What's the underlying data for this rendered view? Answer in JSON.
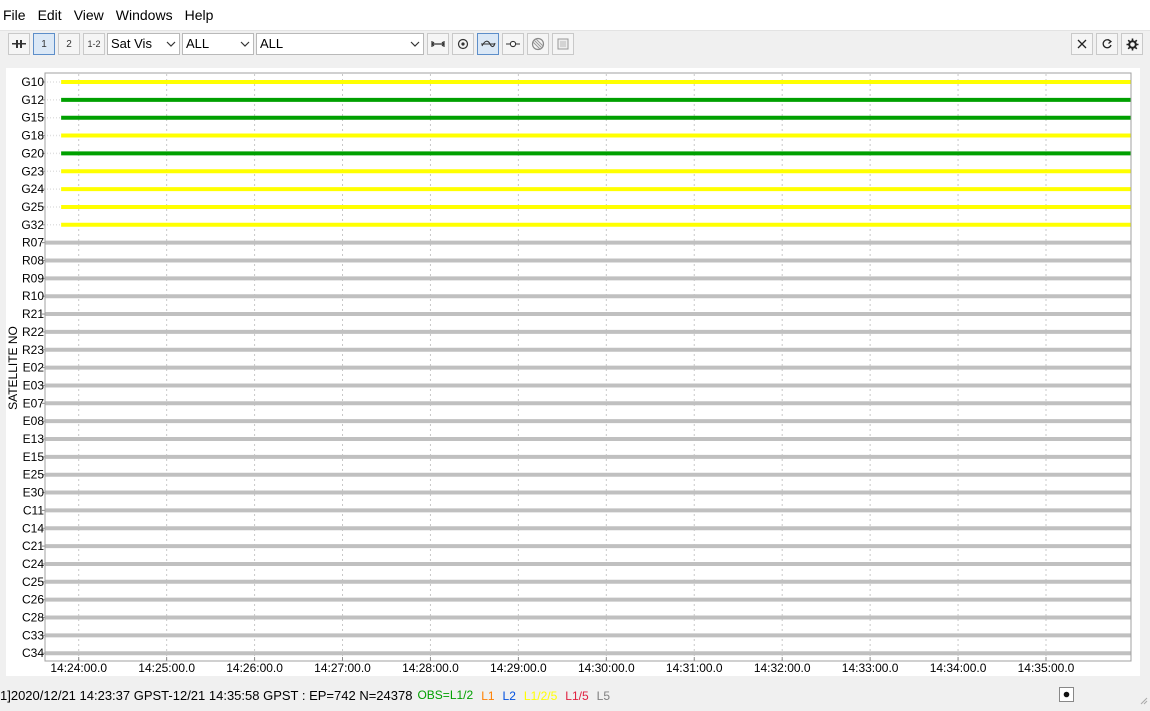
{
  "menu": [
    "File",
    "Edit",
    "View",
    "Windows",
    "Help"
  ],
  "toolbar": {
    "btn_1": "1",
    "btn_2": "2",
    "btn_12": "1-2",
    "plot_type": "Sat Vis",
    "sys_filter": "ALL",
    "sat_filter": "ALL"
  },
  "chart_data": {
    "type": "timeline",
    "ylabel": "SATELLITE NO",
    "x_ticks": [
      "14:24:00.0",
      "14:25:00.0",
      "14:26:00.0",
      "14:27:00.0",
      "14:28:00.0",
      "14:29:00.0",
      "14:30:00.0",
      "14:31:00.0",
      "14:32:00.0",
      "14:33:00.0",
      "14:34:00.0",
      "14:35:00.0"
    ],
    "x_range": [
      "14:23:37",
      "14:35:58"
    ],
    "colors": {
      "L1/2": "#00a000",
      "L1/2/5": "#ffff00",
      "none": "#c0c0c0"
    },
    "satellites": [
      {
        "id": "G10",
        "obs": "L1/2/5",
        "start": "14:23:48"
      },
      {
        "id": "G12",
        "obs": "L1/2",
        "start": "14:23:48"
      },
      {
        "id": "G15",
        "obs": "L1/2",
        "start": "14:23:48"
      },
      {
        "id": "G18",
        "obs": "L1/2/5",
        "start": "14:23:48"
      },
      {
        "id": "G20",
        "obs": "L1/2",
        "start": "14:23:48"
      },
      {
        "id": "G23",
        "obs": "L1/2/5",
        "start": "14:23:48"
      },
      {
        "id": "G24",
        "obs": "L1/2/5",
        "start": "14:23:48"
      },
      {
        "id": "G25",
        "obs": "L1/2/5",
        "start": "14:23:48"
      },
      {
        "id": "G32",
        "obs": "L1/2/5",
        "start": "14:23:48"
      },
      {
        "id": "R07",
        "obs": "none"
      },
      {
        "id": "R08",
        "obs": "none"
      },
      {
        "id": "R09",
        "obs": "none"
      },
      {
        "id": "R10",
        "obs": "none"
      },
      {
        "id": "R21",
        "obs": "none"
      },
      {
        "id": "R22",
        "obs": "none"
      },
      {
        "id": "R23",
        "obs": "none"
      },
      {
        "id": "E02",
        "obs": "none"
      },
      {
        "id": "E03",
        "obs": "none"
      },
      {
        "id": "E07",
        "obs": "none"
      },
      {
        "id": "E08",
        "obs": "none"
      },
      {
        "id": "E13",
        "obs": "none"
      },
      {
        "id": "E15",
        "obs": "none"
      },
      {
        "id": "E25",
        "obs": "none"
      },
      {
        "id": "E30",
        "obs": "none"
      },
      {
        "id": "C11",
        "obs": "none"
      },
      {
        "id": "C14",
        "obs": "none"
      },
      {
        "id": "C21",
        "obs": "none"
      },
      {
        "id": "C24",
        "obs": "none"
      },
      {
        "id": "C25",
        "obs": "none"
      },
      {
        "id": "C26",
        "obs": "none"
      },
      {
        "id": "C28",
        "obs": "none"
      },
      {
        "id": "C33",
        "obs": "none"
      },
      {
        "id": "C34",
        "obs": "none"
      }
    ]
  },
  "status": {
    "text": "1]2020/12/21 14:23:37 GPST-12/21 14:35:58 GPST : EP=742 N=24378",
    "obs_label": "OBS=L1/2",
    "freqs": [
      {
        "label": "L1",
        "color": "#ff8000"
      },
      {
        "label": "L2",
        "color": "#0050e0"
      },
      {
        "label": "L1/2/5",
        "color": "#ffff00"
      },
      {
        "label": "L1/5",
        "color": "#e02040"
      },
      {
        "label": "L5",
        "color": "#808080"
      }
    ],
    "obs_color": "#00a000"
  }
}
